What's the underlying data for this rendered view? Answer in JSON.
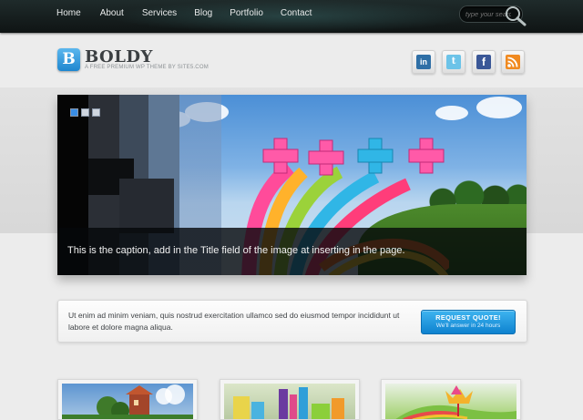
{
  "nav": {
    "items": [
      "Home",
      "About",
      "Services",
      "Blog",
      "Portfolio",
      "Contact"
    ]
  },
  "search": {
    "placeholder": "type your search"
  },
  "brand": {
    "logo_letter": "B",
    "name": "BOLDY",
    "tagline": "A FREE PREMIUM WP THEME BY SITE5.COM"
  },
  "social": [
    {
      "icon": "linkedin-icon",
      "glyph": "in"
    },
    {
      "icon": "twitter-icon",
      "glyph": "t"
    },
    {
      "icon": "facebook-icon",
      "glyph": "f"
    },
    {
      "icon": "rss-icon",
      "glyph": ")"
    }
  ],
  "slider": {
    "caption": "This is the caption, add in the Title field of the image at inserting in the page.",
    "dots": 3
  },
  "callout": {
    "text": "Ut enim ad minim veniam, quis nostrud exercitation ullamco sed do eiusmod tempor incididunt ut labore et dolore magna aliqua.",
    "button_label": "REQUEST QUOTE!",
    "button_sub": "We'll answer in 24 hours"
  },
  "colors": {
    "accent": "#1e86cf",
    "nav_bg": "#151c1c",
    "page_bg": "#ececec"
  }
}
